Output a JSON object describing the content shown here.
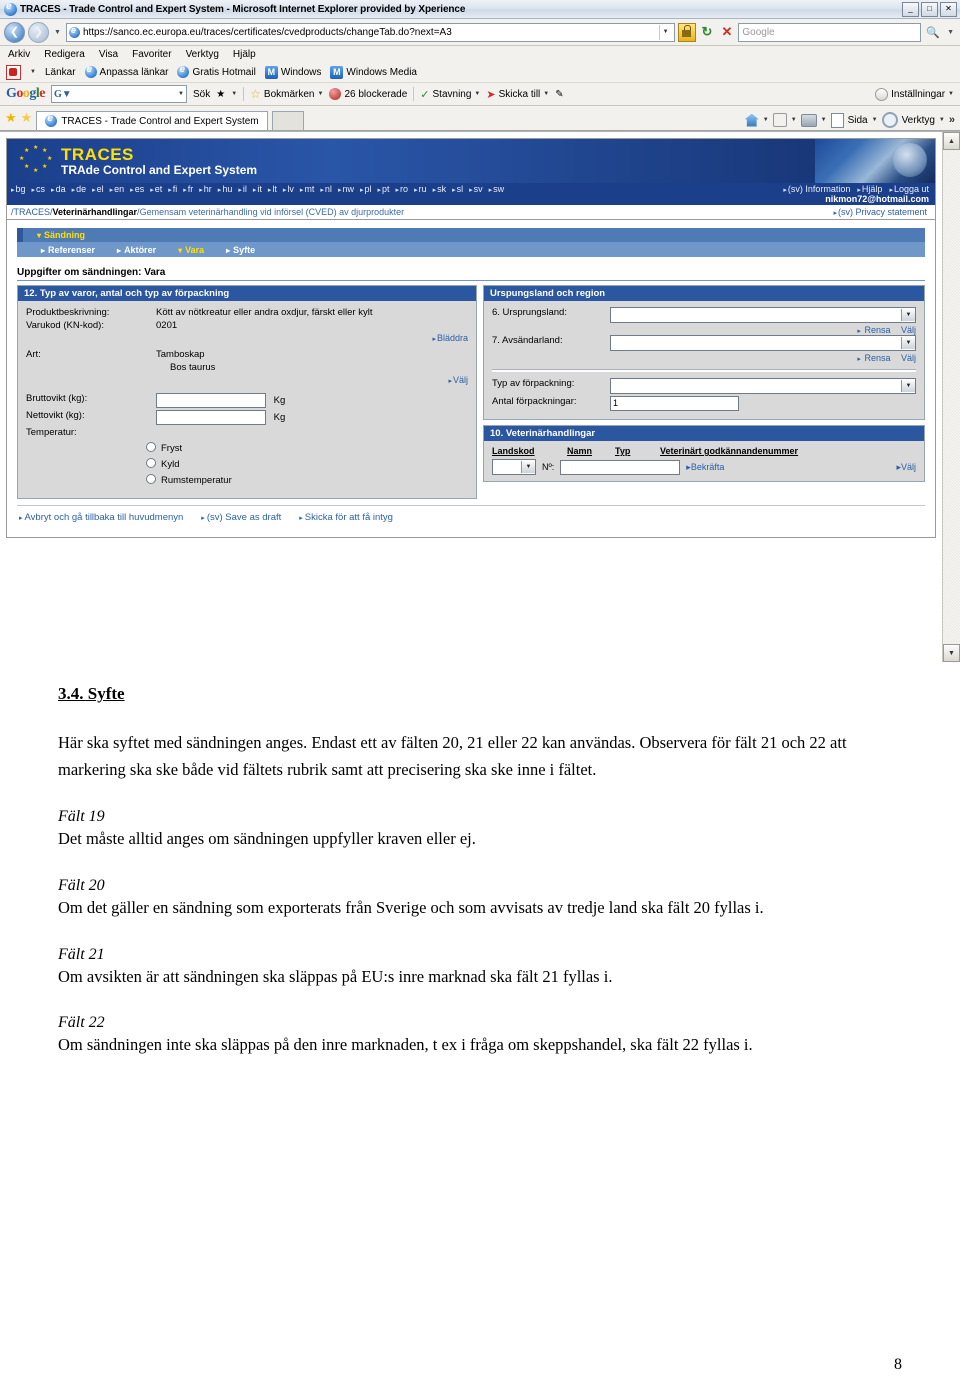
{
  "browser": {
    "title": "TRACES - Trade Control and Expert System - Microsoft Internet Explorer provided by Xperience",
    "window_buttons": {
      "minimize": "_",
      "maximize": "□",
      "close": "✕"
    },
    "url": "https://sanco.ec.europa.eu/traces/certificates/cvedproducts/changeTab.do?next=A3",
    "search_placeholder": "Google",
    "menu": [
      "Arkiv",
      "Redigera",
      "Visa",
      "Favoriter",
      "Verktyg",
      "Hjälp"
    ],
    "links_bar": [
      "Länkar",
      "Anpassa länkar",
      "Gratis Hotmail",
      "Windows",
      "Windows Media"
    ],
    "google_toolbar": {
      "logo": "Google",
      "search_value": "",
      "search_button": "Sök",
      "bookmarks": "Bokmärken",
      "blocked": "26 blockerade",
      "spelling": "Stavning",
      "send_to": "Skicka till",
      "settings": "Inställningar"
    },
    "tab_label": "TRACES - Trade Control and Expert System",
    "command_bar": {
      "page": "Sida",
      "tools": "Verktyg",
      "overflow": "»"
    }
  },
  "traces": {
    "logo_title": "TRACES",
    "logo_subtitle": "TRAde Control and Expert System",
    "languages": [
      "bg",
      "cs",
      "da",
      "de",
      "el",
      "en",
      "es",
      "et",
      "fi",
      "fr",
      "hr",
      "hu",
      "il",
      "it",
      "lt",
      "lv",
      "mt",
      "nl",
      "nw",
      "pl",
      "pt",
      "ro",
      "ru",
      "sk",
      "sl",
      "sv",
      "sw"
    ],
    "account_links": [
      "(sv) Information",
      "Hjälp",
      "Logga ut"
    ],
    "account_email": "nikmon72@hotmail.com",
    "privacy": "(sv) Privacy statement",
    "breadcrumb_root": "/TRACES/",
    "breadcrumb_section": "Veterinärhandlingar",
    "breadcrumb_sep": "/",
    "breadcrumb_page": "Gemensam veterinärhandling vid införsel (CVED) av djurprodukter",
    "tabs_parent": "Sändning",
    "tabs": [
      {
        "label": "Referenser",
        "active": false
      },
      {
        "label": "Aktörer",
        "active": false
      },
      {
        "label": "Vara",
        "active": true
      },
      {
        "label": "Syfte",
        "active": false
      }
    ],
    "section_title": "Uppgifter om sändningen: Vara",
    "panel_goods": {
      "header": "12. Typ av varor, antal och typ av förpackning",
      "product_label": "Produktbeskrivning:",
      "product_value": "Kött av nötkreatur eller andra oxdjur, färskt eller kylt",
      "code_label": "Varukod (KN-kod):",
      "code_value": "0201",
      "browse_link": "Bläddra",
      "species_label": "Art:",
      "species_value": "Tamboskap",
      "species_latin": "Bos taurus",
      "select_link": "Välj",
      "gross_label": "Bruttovikt (kg):",
      "gross_value": "",
      "gross_unit": "Kg",
      "net_label": "Nettovikt (kg):",
      "net_value": "",
      "net_unit": "Kg",
      "temp_label": "Temperatur:",
      "temp_options": [
        "Fryst",
        "Kyld",
        "Rumstemperatur"
      ]
    },
    "panel_origin": {
      "header": "Urspungsland och region",
      "origin_label": "6. Ursprungsland:",
      "origin_value": "",
      "origin_clear": "Rensa",
      "origin_select": "Välj",
      "sender_label": "7. Avsändarland:",
      "sender_value": "",
      "sender_clear": "Rensa",
      "sender_select": "Välj",
      "packaging_label": "Typ av förpackning:",
      "packaging_value": "",
      "count_label": "Antal förpackningar:",
      "count_value": "1"
    },
    "panel_vet": {
      "header": "10. Veterinärhandlingar",
      "columns": [
        "Landskod",
        "Namn",
        "Typ",
        "Veterinärt godkännandenummer"
      ],
      "country_value": "",
      "number_label": "Nº:",
      "number_value": "",
      "confirm_link": "Bekräfta",
      "select_link": "Välj"
    },
    "actions": [
      "Avbryt och gå tillbaka till huvudmenyn",
      "(sv) Save as draft",
      "Skicka för att få intyg"
    ]
  },
  "document": {
    "heading": "3.4. Syfte",
    "intro": "Här ska syftet med sändningen anges. Endast ett av fälten 20, 21 eller 22 kan användas. Observera för fält 21 och 22 att markering ska ske både vid fältets rubrik samt att precisering ska ske inne i fältet.",
    "blocks": [
      {
        "label": "Fält 19",
        "text": "Det måste alltid anges om sändningen uppfyller kraven eller ej."
      },
      {
        "label": "Fält 20",
        "text": "Om det gäller en sändning som exporterats från Sverige och som avvisats av tredje land ska fält 20 fyllas i."
      },
      {
        "label": "Fält 21",
        "text": "Om avsikten är att sändningen ska släppas på EU:s inre marknad ska fält 21 fyllas i."
      },
      {
        "label": "Fält 22",
        "text": "Om sändningen inte ska släppas på den inre marknaden, t ex i fråga om skeppshandel, ska fält 22 fyllas i."
      }
    ],
    "page_number": "8"
  }
}
